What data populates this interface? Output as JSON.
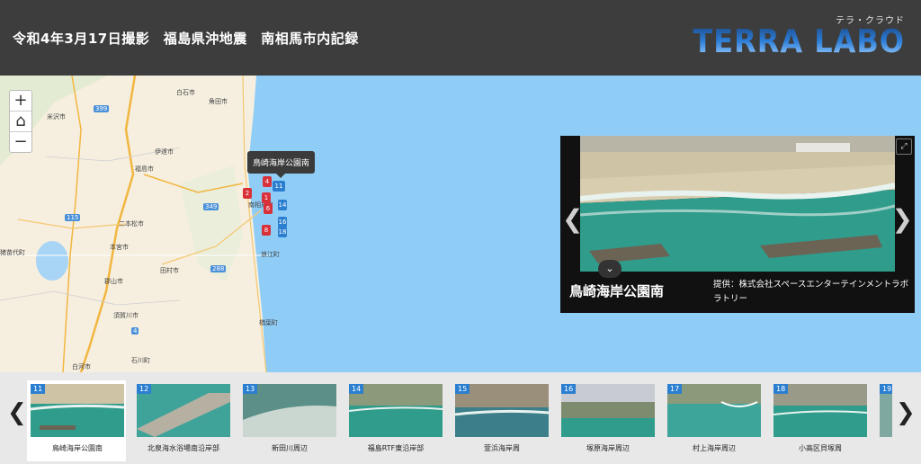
{
  "header": {
    "title": "令和4年3月17日撮影　福島県沖地震　南相馬市内記録",
    "logo_sub": "テラ・クラウド",
    "logo_main": "TERRA LABO"
  },
  "map": {
    "labels": [
      "白石市",
      "角田市",
      "米沢市",
      "伊達市",
      "福島市",
      "二本松市",
      "本宮市",
      "猪苗代町",
      "田村市",
      "郡山市",
      "須賀川市",
      "石川町",
      "白河市",
      "浪江町",
      "楢葉町",
      "南相馬市"
    ],
    "roads": [
      "399",
      "115",
      "288",
      "4",
      "349"
    ],
    "tooltip": "鳥崎海岸公園南",
    "controls": {
      "zoom_in": "+",
      "home": "⌂",
      "zoom_out": "−"
    },
    "pins": [
      {
        "label": "2",
        "color": "red"
      },
      {
        "label": "4",
        "color": "red"
      },
      {
        "label": "1",
        "color": "red"
      },
      {
        "label": "6",
        "color": "red"
      },
      {
        "label": "8",
        "color": "red"
      },
      {
        "label": "11",
        "color": "blue"
      },
      {
        "label": "14",
        "color": "blue"
      },
      {
        "label": "16",
        "color": "blue"
      },
      {
        "label": "18",
        "color": "blue"
      }
    ]
  },
  "viewer": {
    "name": "鳥崎海岸公園南",
    "credit": "提供：株式会社スペースエンターテインメントラボラトリー",
    "prev": "❮",
    "next": "❯",
    "collapse": "⌄",
    "expand": "⤢"
  },
  "strip": {
    "prev": "❮",
    "next": "❯",
    "items": [
      {
        "num": "11",
        "label": "鳥崎海岸公園南"
      },
      {
        "num": "12",
        "label": "北泉海水浴場南沿岸部"
      },
      {
        "num": "13",
        "label": "新田川周辺"
      },
      {
        "num": "14",
        "label": "福島RTF東沿岸部"
      },
      {
        "num": "15",
        "label": "萱浜海岸周"
      },
      {
        "num": "16",
        "label": "塚原海岸周辺"
      },
      {
        "num": "17",
        "label": "村上海岸周辺"
      },
      {
        "num": "18",
        "label": "小高区貝塚周"
      },
      {
        "num": "19",
        "label": ""
      }
    ]
  },
  "colors": {
    "header_bg": "#3d3d3d",
    "sea": "#8fcdf7",
    "pin_red": "#d9313a",
    "pin_blue": "#2c7fd0"
  }
}
